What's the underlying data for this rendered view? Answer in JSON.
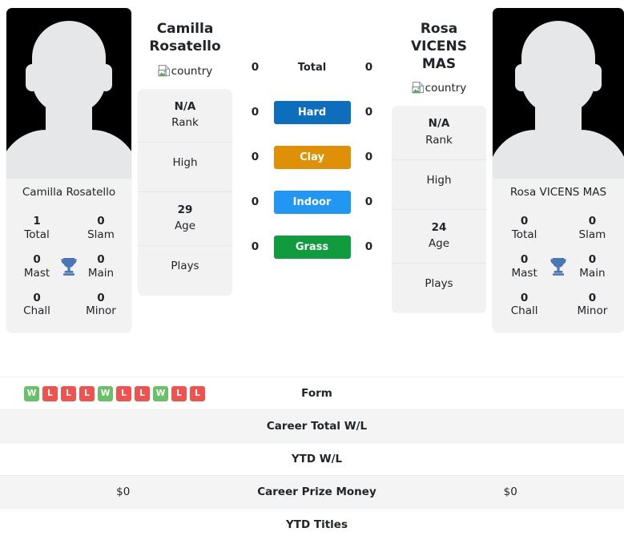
{
  "players": {
    "left": {
      "name": "Camilla Rosatello",
      "name_line1": "Camilla",
      "name_line2": "Rosatello",
      "country_alt": "country",
      "photo_caption": "Camilla Rosatello",
      "titles": [
        {
          "value": "1",
          "label": "Total"
        },
        {
          "value": "0",
          "label": "Slam"
        },
        {
          "value": "0",
          "label": "Mast"
        },
        {
          "value": "0",
          "label": "Main"
        },
        {
          "value": "0",
          "label": "Chall"
        },
        {
          "value": "0",
          "label": "Minor"
        }
      ],
      "info": [
        {
          "value": "N/A",
          "label": "Rank"
        },
        {
          "value": "",
          "label": "High"
        },
        {
          "value": "29",
          "label": "Age"
        },
        {
          "value": "",
          "label": "Plays"
        }
      ],
      "surface_counts": [
        "0",
        "0",
        "0",
        "0",
        "0"
      ],
      "form": [
        "W",
        "L",
        "L",
        "L",
        "W",
        "L",
        "L",
        "W",
        "L",
        "L"
      ],
      "career_total_wl": "",
      "ytd_wl": "",
      "career_prize_money": "$0",
      "ytd_titles": ""
    },
    "right": {
      "name": "Rosa VICENS MAS",
      "name_line1": "Rosa VICENS",
      "name_line2": "MAS",
      "country_alt": "country",
      "photo_caption": "Rosa VICENS MAS",
      "titles": [
        {
          "value": "0",
          "label": "Total"
        },
        {
          "value": "0",
          "label": "Slam"
        },
        {
          "value": "0",
          "label": "Mast"
        },
        {
          "value": "0",
          "label": "Main"
        },
        {
          "value": "0",
          "label": "Chall"
        },
        {
          "value": "0",
          "label": "Minor"
        }
      ],
      "info": [
        {
          "value": "N/A",
          "label": "Rank"
        },
        {
          "value": "",
          "label": "High"
        },
        {
          "value": "24",
          "label": "Age"
        },
        {
          "value": "",
          "label": "Plays"
        }
      ],
      "surface_counts": [
        "0",
        "0",
        "0",
        "0",
        "0"
      ],
      "form": [],
      "career_total_wl": "",
      "ytd_wl": "",
      "career_prize_money": "$0",
      "ytd_titles": ""
    }
  },
  "surfaces": [
    {
      "label": "Total",
      "color": "transparent",
      "plain": true
    },
    {
      "label": "Hard",
      "color": "#0d6ebd",
      "plain": false
    },
    {
      "label": "Clay",
      "color": "#df9007",
      "plain": false
    },
    {
      "label": "Indoor",
      "color": "#2196f3",
      "plain": false
    },
    {
      "label": "Grass",
      "color": "#109b3e",
      "plain": false
    }
  ],
  "table_rows": [
    {
      "label": "Form",
      "left": "",
      "right": "",
      "alt": false
    },
    {
      "label": "Career Total W/L",
      "left": "",
      "right": "",
      "alt": true
    },
    {
      "label": "YTD W/L",
      "left": "",
      "right": "",
      "alt": false
    },
    {
      "label": "Career Prize Money",
      "left": "$0",
      "right": "$0",
      "alt": true
    },
    {
      "label": "YTD Titles",
      "left": "",
      "right": "",
      "alt": false
    }
  ],
  "colors": {
    "win_badge": "#6abf69",
    "loss_badge": "#ef5350",
    "trophy": "#4a76b8",
    "card_bg": "#f2f2f2",
    "row_alt_bg": "#f4f4f4",
    "photo_bg": "#000000",
    "silhouette": "#e6e7e8"
  }
}
